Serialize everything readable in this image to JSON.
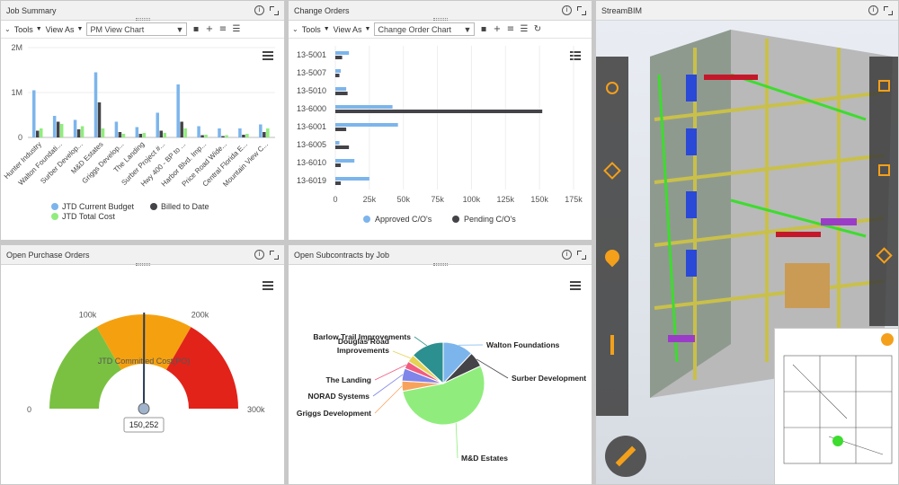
{
  "job_summary": {
    "title": "Job Summary",
    "toolbar": {
      "tools": "Tools",
      "view_as": "View As",
      "view": "PM View Chart"
    },
    "chart_data": {
      "type": "bar",
      "y_ticks": [
        "0",
        "1M",
        "2M"
      ],
      "ylim": [
        0,
        2000000
      ],
      "categories": [
        "Hunter Industry",
        "Walton Foundati...",
        "Surber Develop...",
        "M&D Estates",
        "Griggs Develop...",
        "The Landing",
        "Surber Project #...",
        "Hwy 400 - BP to ...",
        "Harbor Blvd. Imp...",
        "Price Road Wide...",
        "Central Florida E...",
        "Mountain View C..."
      ],
      "series": [
        {
          "name": "JTD Current Budget",
          "color": "#7cb5ec",
          "values": [
            1050000,
            480000,
            390000,
            1450000,
            350000,
            230000,
            550000,
            1180000,
            250000,
            200000,
            200000,
            290000
          ]
        },
        {
          "name": "Billed to Date",
          "color": "#434348",
          "values": [
            150000,
            350000,
            180000,
            780000,
            120000,
            80000,
            150000,
            350000,
            50000,
            30000,
            60000,
            120000
          ]
        },
        {
          "name": "JTD Total Cost",
          "color": "#90ed7d",
          "values": [
            200000,
            300000,
            250000,
            200000,
            80000,
            100000,
            100000,
            200000,
            60000,
            50000,
            80000,
            200000
          ]
        }
      ]
    }
  },
  "change_orders": {
    "title": "Change Orders",
    "toolbar": {
      "tools": "Tools",
      "view_as": "View As",
      "view": "Change Order Chart"
    },
    "chart_data": {
      "type": "bar",
      "orientation": "horizontal",
      "categories": [
        "13-5001",
        "13-5007",
        "13-5010",
        "13-6000",
        "13-6001",
        "13-6005",
        "13-6010",
        "13-6019"
      ],
      "x_ticks": [
        "0",
        "25k",
        "50k",
        "75k",
        "100k",
        "125k",
        "150k",
        "175k"
      ],
      "xlim": [
        0,
        175000
      ],
      "series": [
        {
          "name": "Approved C/O's",
          "color": "#7cb5ec",
          "values": [
            10000,
            4000,
            8000,
            42000,
            46000,
            3000,
            14000,
            25000
          ]
        },
        {
          "name": "Pending C/O's",
          "color": "#434348",
          "values": [
            5000,
            3000,
            9000,
            152000,
            8000,
            10000,
            4000,
            4000
          ]
        }
      ]
    }
  },
  "purchase_orders": {
    "title": "Open Purchase Orders",
    "gauge": {
      "label": "JTD Committed Cost(PO)",
      "min_label": "0",
      "max_label": "300k",
      "tick_100": "100k",
      "tick_200": "200k",
      "value": 150252,
      "value_label": "150,252",
      "max": 300000
    }
  },
  "subcontracts": {
    "title": "Open Subcontracts by Job",
    "chart_data": {
      "type": "pie",
      "slices": [
        {
          "name": "Walton Foundations",
          "value": 12,
          "color": "#7cb5ec"
        },
        {
          "name": "Surber Development",
          "value": 6,
          "color": "#434348"
        },
        {
          "name": "M&D Estates",
          "value": 54,
          "color": "#90ed7d"
        },
        {
          "name": "Griggs Development",
          "value": 4,
          "color": "#f7a35c"
        },
        {
          "name": "NORAD Systems",
          "value": 5,
          "color": "#8085e9"
        },
        {
          "name": "The Landing",
          "value": 3,
          "color": "#f15c80"
        },
        {
          "name": "Douglas Road Improvements",
          "value": 3,
          "color": "#e4d354"
        },
        {
          "name": "Barlow Trail Improvements",
          "value": 13,
          "color": "#2b908f"
        }
      ]
    }
  },
  "streambim": {
    "title": "StreamBIM"
  }
}
